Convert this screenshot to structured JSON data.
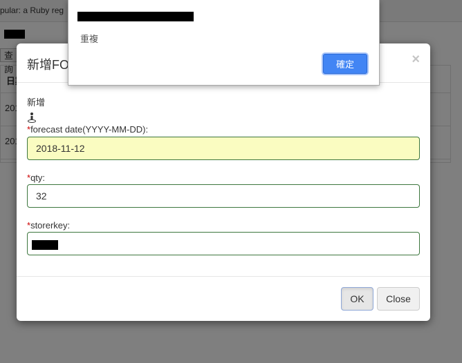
{
  "background": {
    "tab_text": "pular: a Ruby reg",
    "query_button_label": "查詢",
    "table_header_first": "日期",
    "row1_prefix": "201",
    "row2_prefix": "201"
  },
  "modal": {
    "title": "新增FO",
    "close_symbol": "×",
    "form_caption": "新增",
    "required_mark": "*",
    "fields": {
      "forecast_date": {
        "label": "forecast date(YYYY-MM-DD):",
        "value": "2018-11-12"
      },
      "qty": {
        "label": "qty:",
        "value": "32"
      },
      "storerkey": {
        "label": "storerkey:"
      }
    },
    "buttons": {
      "ok": "OK",
      "close": "Close"
    }
  },
  "alert": {
    "message": "重複",
    "confirm_label": "確定"
  },
  "colors": {
    "input_border": "#3c763d",
    "date_bg": "#fafcc1",
    "alert_button": "#4285f4",
    "required": "#cc0000"
  }
}
